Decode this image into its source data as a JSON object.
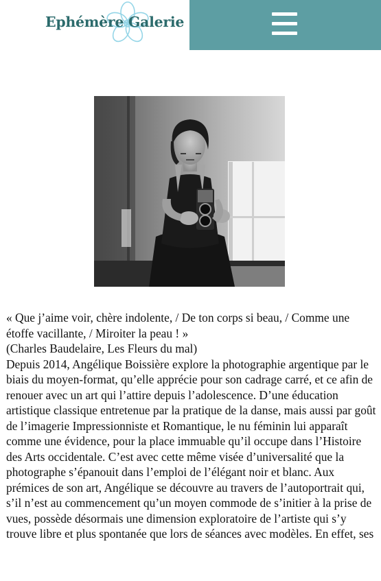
{
  "header": {
    "logo_text": "Ephémère Galerie",
    "logo_icon": "flower-icon",
    "menu_icon": "hamburger-icon",
    "colors": {
      "brand_text": "#2c6b6c",
      "menu_background": "#5d9ea3",
      "flower": "#8fd3e6"
    }
  },
  "photo": {
    "alt": "",
    "icon": "photograph-woman-with-camera"
  },
  "article": {
    "quote": "« Que j’aime voir, chère indolente, / De ton corps si beau, / Comme une étoffe vacillante, / Miroiter la peau ! »",
    "attribution": "(Charles Baudelaire, Les Fleurs du mal)",
    "body": "Depuis 2014, Angélique Boissière explore la photographie argentique par le biais du moyen-format, qu’elle apprécie pour son cadrage carré, et ce afin de renouer avec un art qui l’attire depuis l’adolescence. D’une éducation artistique classique entretenue par la pratique de la danse, mais aussi par goût de l’imagerie Impressionniste et Romantique, le nu féminin lui apparaît comme une évidence, pour la place immuable qu’il occupe dans l’Histoire des Arts occidentale. C’est avec cette même visée d’universalité que la photographe s’épanouit dans l’emploi de l’élégant noir et blanc. Aux prémices de son art, Angélique se découvre au travers de l’autoportrait qui, s’il n’est au commencement qu’un moyen commode de s’initier à la prise de vues, possède désormais une dimension exploratoire de l’artiste qui s’y trouve libre et plus spontanée que lors de séances avec modèles. En effet, ses"
  }
}
